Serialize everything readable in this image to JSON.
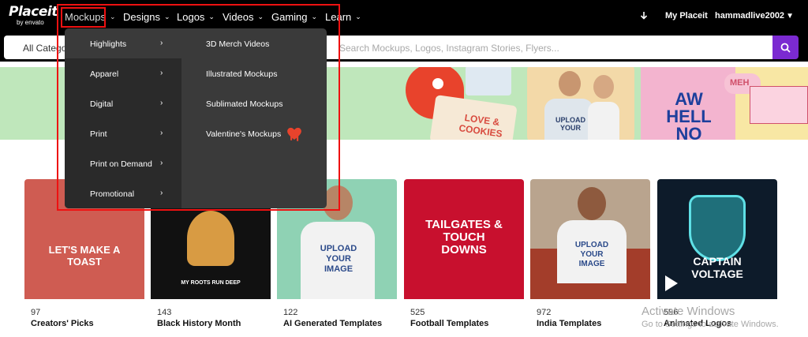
{
  "logo": {
    "main": "Placeit",
    "sub": "by envato"
  },
  "nav": {
    "mockups": "Mockups",
    "designs": "Designs",
    "logos": "Logos",
    "videos": "Videos",
    "gaming": "Gaming",
    "learn": "Learn",
    "my_placeit": "My Placeit",
    "user": "hammadlive2002"
  },
  "search": {
    "category": "All Categories",
    "placeholder": "Search Mockups, Logos, Instagram Stories, Flyers..."
  },
  "dropdown": {
    "left": [
      "Highlights",
      "Apparel",
      "Digital",
      "Print",
      "Print on Demand",
      "Promotional"
    ],
    "right": [
      "3D Merch Videos",
      "Illustrated Mockups",
      "Sublimated Mockups",
      "Valentine's Mockups"
    ]
  },
  "banner": {
    "love_cookies": "LOVE & COOKIES",
    "aw_hell_no": "AW HELL NO",
    "meh": "MEH",
    "upload_small": "UPLOAD YOUR"
  },
  "cards": [
    {
      "count": "97",
      "title": "Creators' Picks",
      "art": "LET'S MAKE A TOAST"
    },
    {
      "count": "143",
      "title": "Black History Month",
      "art": "MY ROOTS RUN DEEP"
    },
    {
      "count": "122",
      "title": "AI Generated Templates",
      "art": "UPLOAD YOUR IMAGE"
    },
    {
      "count": "525",
      "title": "Football Templates",
      "art": "TAILGATES & TOUCH DOWNS"
    },
    {
      "count": "972",
      "title": "India Templates",
      "art": "UPLOAD YOUR IMAGE"
    },
    {
      "count": "596",
      "title": "Animated Logos",
      "art": "CAPTAIN VOLTAGE"
    }
  ],
  "watermark": {
    "title": "Activate Windows",
    "sub": "Go to Settings to activate Windows."
  },
  "colors": {
    "accent": "#7b2ad1",
    "highlight_box": "#e11111"
  }
}
